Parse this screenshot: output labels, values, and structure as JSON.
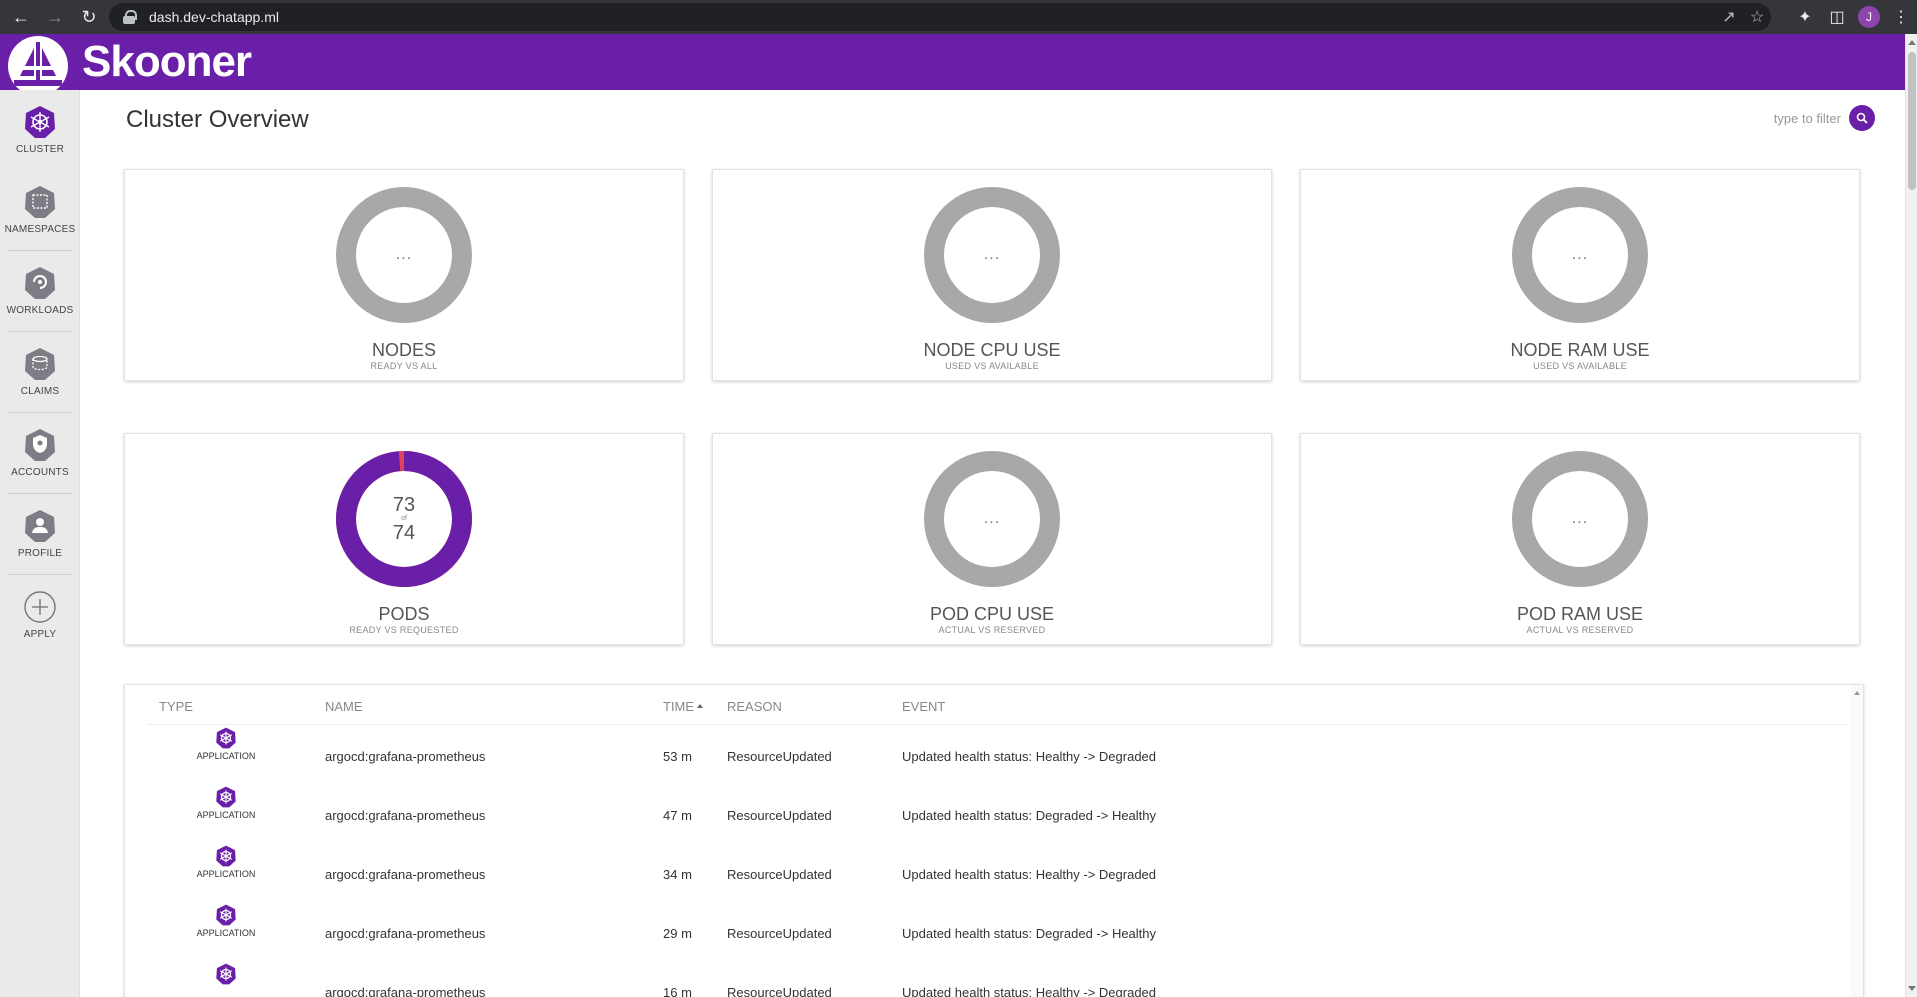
{
  "browser": {
    "url": "dash.dev-chatapp.ml",
    "profile_initial": "J"
  },
  "app": {
    "name": "Skooner",
    "brand_color": "#6a1fa8"
  },
  "sidebar": {
    "items": [
      {
        "label": "CLUSTER",
        "icon": "helm-wheel-icon"
      },
      {
        "label": "NAMESPACES",
        "icon": "namespace-icon"
      },
      {
        "label": "WORKLOADS",
        "icon": "deploy-icon"
      },
      {
        "label": "CLAIMS",
        "icon": "pvc-icon"
      },
      {
        "label": "ACCOUNTS",
        "icon": "service-account-icon"
      },
      {
        "label": "PROFILE",
        "icon": "user-icon"
      },
      {
        "label": "APPLY",
        "icon": "plus-circle-icon"
      }
    ]
  },
  "page": {
    "title": "Cluster Overview",
    "filter_placeholder": "type to filter"
  },
  "cards": [
    {
      "title": "NODES",
      "subtitle": "READY VS ALL",
      "center": "..."
    },
    {
      "title": "NODE CPU USE",
      "subtitle": "USED VS AVAILABLE",
      "center": "..."
    },
    {
      "title": "NODE RAM USE",
      "subtitle": "USED VS AVAILABLE",
      "center": "..."
    },
    {
      "title": "PODS",
      "subtitle": "READY VS REQUESTED",
      "value": "73",
      "of": "of",
      "total": "74",
      "ready": 73,
      "requested": 74,
      "ready_color": "#6a1fa8",
      "not_ready_color": "#e0435a"
    },
    {
      "title": "POD CPU USE",
      "subtitle": "ACTUAL VS RESERVED",
      "center": "..."
    },
    {
      "title": "POD RAM USE",
      "subtitle": "ACTUAL VS RESERVED",
      "center": "..."
    }
  ],
  "events": {
    "columns": [
      "TYPE",
      "NAME",
      "TIME",
      "REASON",
      "EVENT"
    ],
    "rows": [
      {
        "type": "APPLICATION",
        "name": "argocd:grafana-prometheus",
        "time": "53 m",
        "reason": "ResourceUpdated",
        "event": "Updated health status: Healthy -> Degraded"
      },
      {
        "type": "APPLICATION",
        "name": "argocd:grafana-prometheus",
        "time": "47 m",
        "reason": "ResourceUpdated",
        "event": "Updated health status: Degraded -> Healthy"
      },
      {
        "type": "APPLICATION",
        "name": "argocd:grafana-prometheus",
        "time": "34 m",
        "reason": "ResourceUpdated",
        "event": "Updated health status: Healthy -> Degraded"
      },
      {
        "type": "APPLICATION",
        "name": "argocd:grafana-prometheus",
        "time": "29 m",
        "reason": "ResourceUpdated",
        "event": "Updated health status: Degraded -> Healthy"
      },
      {
        "type": "",
        "name": "argocd:grafana-prometheus",
        "time": "16 m",
        "reason": "ResourceUpdated",
        "event": "Updated health status: Healthy -> Degraded"
      }
    ]
  }
}
